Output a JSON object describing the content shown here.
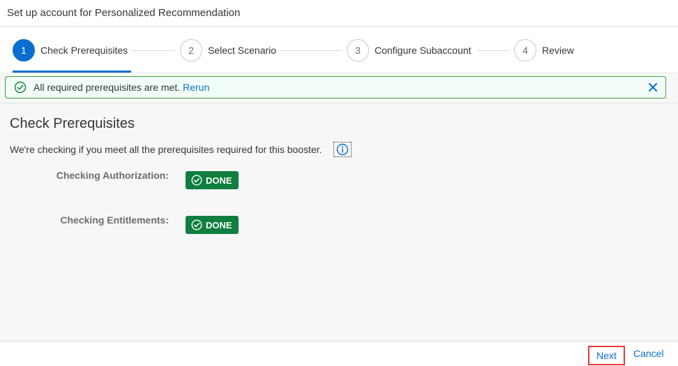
{
  "window": {
    "title": "Set up account for Personalized Recommendation"
  },
  "wizard": {
    "steps": [
      {
        "number": "1",
        "label": "Check Prerequisites",
        "state": "active"
      },
      {
        "number": "2",
        "label": "Select Scenario",
        "state": "upcoming"
      },
      {
        "number": "3",
        "label": "Configure Subaccount",
        "state": "upcoming"
      },
      {
        "number": "4",
        "label": "Review",
        "state": "upcoming"
      }
    ]
  },
  "message": {
    "text": "All required prerequisites are met.",
    "link": "Rerun",
    "type": "success",
    "icon": "success-check-icon",
    "close_icon": "close-icon"
  },
  "main": {
    "title": "Check Prerequisites",
    "description": "We're checking if you meet all the prerequisites required for this booster.",
    "info_icon": "info-icon",
    "checks": [
      {
        "label": "Checking Authorization:",
        "status": "DONE"
      },
      {
        "label": "Checking Entitlements:",
        "status": "DONE"
      }
    ]
  },
  "footer": {
    "next_label": "Next",
    "cancel_label": "Cancel"
  },
  "colors": {
    "accent": "#0a6ed1",
    "success": "#107e3e",
    "highlight": "#e23b3b"
  }
}
